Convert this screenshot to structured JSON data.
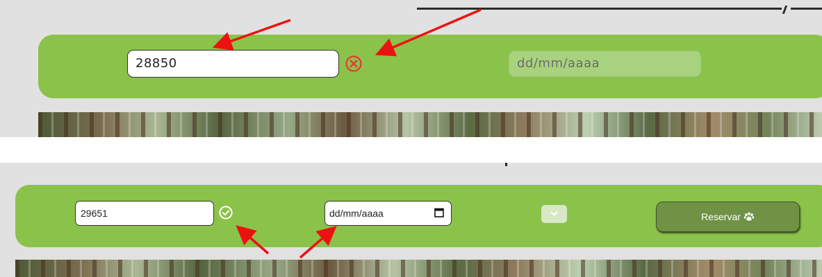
{
  "screenshot_top": {
    "zip_input": {
      "value": "28850"
    },
    "zip_status": {
      "icon": "error-circle-icon",
      "color": "#e53935"
    },
    "date_input": {
      "placeholder": "dd/mm/aaaa",
      "state": "disabled"
    }
  },
  "screenshot_bottom": {
    "zip_input": {
      "value": "29651"
    },
    "zip_status": {
      "icon": "check-circle-icon",
      "color": "#ffffff"
    },
    "date_input": {
      "placeholder": "dd/mm/aaaa",
      "icon": "calendar-icon"
    },
    "select": {
      "icon": "chevron-down-icon"
    },
    "reserve_button": {
      "label": "Reservar",
      "icon": "paw-icon"
    }
  },
  "theme": {
    "bar_green": "#8bc24a",
    "button_green": "#6f9245",
    "annotation_arrow": "#ee1111",
    "page_gray": "#e1e1e1"
  }
}
